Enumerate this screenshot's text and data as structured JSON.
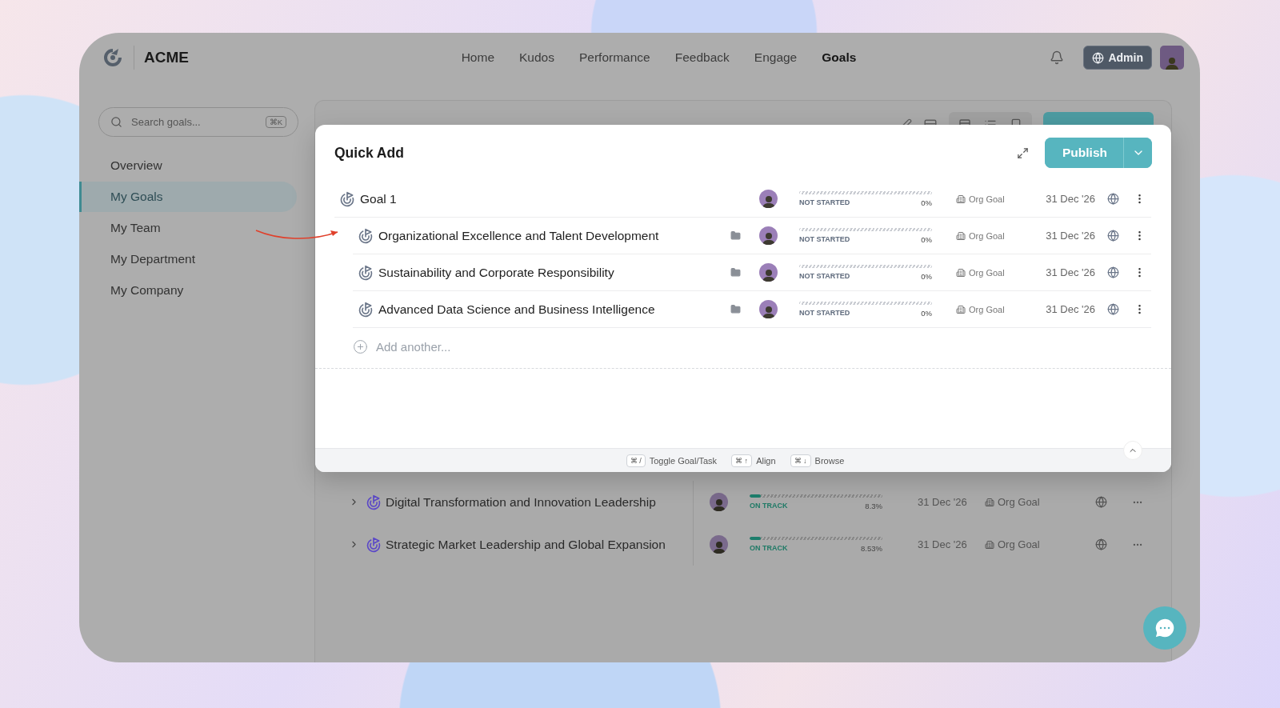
{
  "brand": {
    "name": "ACME"
  },
  "nav": [
    {
      "label": "Home",
      "selected": false
    },
    {
      "label": "Kudos",
      "selected": false
    },
    {
      "label": "Performance",
      "selected": false
    },
    {
      "label": "Feedback",
      "selected": false
    },
    {
      "label": "Engage",
      "selected": false
    },
    {
      "label": "Goals",
      "selected": true
    }
  ],
  "admin_button": "Admin",
  "search": {
    "placeholder": "Search goals...",
    "shortcut": "⌘K"
  },
  "sidebar": {
    "items": [
      {
        "label": "Overview",
        "selected": false
      },
      {
        "label": "My Goals",
        "selected": true
      },
      {
        "label": "My Team",
        "selected": false
      },
      {
        "label": "My Department",
        "selected": false
      },
      {
        "label": "My Company",
        "selected": false
      }
    ]
  },
  "background_goals": [
    {
      "title": "Digital Transformation and Innovation Leadership",
      "status": "ON TRACK",
      "level": 0.083,
      "percent": "8.3%",
      "due": "31 Dec '26",
      "type": "Org Goal"
    },
    {
      "title": "Strategic Market Leadership and Global Expansion",
      "status": "ON TRACK",
      "level": 0.0853,
      "percent": "8.53%",
      "due": "31 Dec '26",
      "type": "Org Goal"
    }
  ],
  "quick_add": {
    "title": "Quick Add",
    "publish": "Publish",
    "goals": [
      {
        "title": "Goal 1",
        "status": "NOT STARTED",
        "level": 0,
        "percent": "0%",
        "type": "Org Goal",
        "due": "31 Dec '26",
        "children": [
          {
            "title": "Organizational Excellence and Talent Development",
            "status": "NOT STARTED",
            "level": 0,
            "percent": "0%",
            "type": "Org Goal",
            "due": "31 Dec '26"
          },
          {
            "title": "Sustainability and Corporate Responsibility",
            "status": "NOT STARTED",
            "level": 0,
            "percent": "0%",
            "type": "Org Goal",
            "due": "31 Dec '26"
          },
          {
            "title": "Advanced Data Science and Business Intelligence",
            "status": "NOT STARTED",
            "level": 0,
            "percent": "0%",
            "type": "Org Goal",
            "due": "31 Dec '26"
          }
        ]
      }
    ],
    "add_placeholder": "Add another...",
    "shortcuts": [
      {
        "keys": "⌘ /",
        "label": "Toggle Goal/Task"
      },
      {
        "keys": "⌘ ↑",
        "label": "Align"
      },
      {
        "keys": "⌘ ↓",
        "label": "Browse"
      }
    ]
  }
}
